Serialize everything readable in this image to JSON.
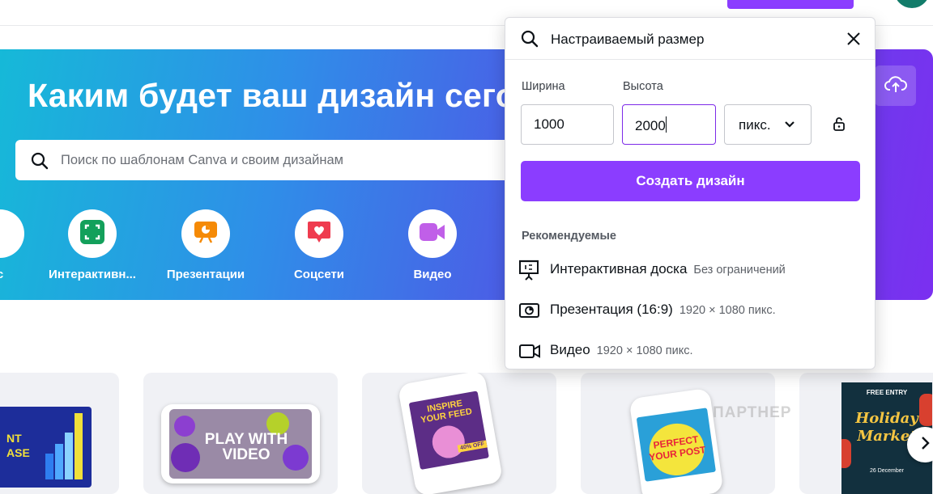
{
  "hero": {
    "title": "Каким будет ваш дизайн сегодня?",
    "search_placeholder": "Поиск по шаблонам Canva и своим дизайнам",
    "categories": [
      {
        "label": "Интерактивн...",
        "icon": "whiteboard-icon",
        "color": "#13a05b"
      },
      {
        "label": "Презентации",
        "icon": "presentation-icon",
        "color": "#f58a06"
      },
      {
        "label": "Соцсети",
        "icon": "heart-chat-icon",
        "color": "#ef3b4f"
      },
      {
        "label": "Видео",
        "icon": "video-camera-icon",
        "color": "#c05fe8"
      }
    ]
  },
  "custom_size": {
    "query": "Настраиваемый размер",
    "width_label": "Ширина",
    "height_label": "Высота",
    "width_value": "1000",
    "height_value": "2000",
    "unit": "пикс.",
    "create_label": "Создать дизайн",
    "recommended_title": "Рекомендуемые",
    "recommended": [
      {
        "name": "Интерактивная доска",
        "dims": "Без ограничений",
        "icon": "whiteboard-icon"
      },
      {
        "name": "Презентация (16:9)",
        "dims": "1920 × 1080 пикс.",
        "icon": "presentation-icon"
      },
      {
        "name": "Видео",
        "dims": "1920 × 1080 пикс.",
        "icon": "video-camera-icon"
      }
    ]
  },
  "templates": {
    "card2_text": "PLAY WITH VIDEO",
    "card3_text": "INSPIRE YOUR FEED",
    "card3_badge": "40% OFF",
    "card4_text": "PERFECT YOUR POST",
    "card5_title": "Holiday Market",
    "card5_top": "FREE ENTRY",
    "card5_bottom": "26 December",
    "card1_text": "NT ASE"
  },
  "watermark": "ПАРТНЕР",
  "colors": {
    "accent": "#8b3dff",
    "avatar": "#127c6a"
  }
}
